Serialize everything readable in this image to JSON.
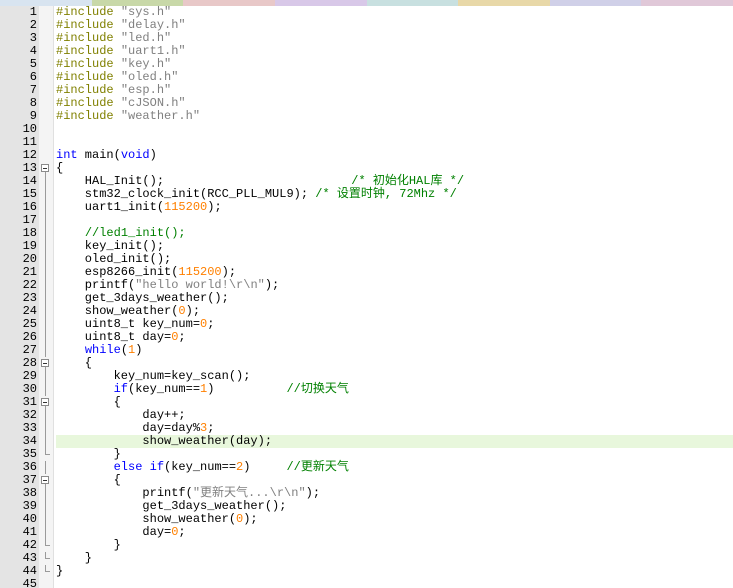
{
  "tab_colors": [
    "#d8e4f0",
    "#c8d8a8",
    "#e8c8c8",
    "#d8c8e8",
    "#c8e0e0",
    "#e8d8a8",
    "#d0d0e8",
    "#e0c8d8"
  ],
  "lines": [
    {
      "n": "1",
      "tokens": [
        {
          "t": "#include ",
          "c": "pp"
        },
        {
          "t": "\"sys.h\"",
          "c": "str"
        }
      ]
    },
    {
      "n": "2",
      "tokens": [
        {
          "t": "#include ",
          "c": "pp"
        },
        {
          "t": "\"delay.h\"",
          "c": "str"
        }
      ]
    },
    {
      "n": "3",
      "tokens": [
        {
          "t": "#include ",
          "c": "pp"
        },
        {
          "t": "\"led.h\"",
          "c": "str"
        }
      ]
    },
    {
      "n": "4",
      "tokens": [
        {
          "t": "#include ",
          "c": "pp"
        },
        {
          "t": "\"uart1.h\"",
          "c": "str"
        }
      ]
    },
    {
      "n": "5",
      "tokens": [
        {
          "t": "#include ",
          "c": "pp"
        },
        {
          "t": "\"key.h\"",
          "c": "str"
        }
      ]
    },
    {
      "n": "6",
      "tokens": [
        {
          "t": "#include ",
          "c": "pp"
        },
        {
          "t": "\"oled.h\"",
          "c": "str"
        }
      ]
    },
    {
      "n": "7",
      "tokens": [
        {
          "t": "#include ",
          "c": "pp"
        },
        {
          "t": "\"esp.h\"",
          "c": "str"
        }
      ]
    },
    {
      "n": "8",
      "tokens": [
        {
          "t": "#include ",
          "c": "pp"
        },
        {
          "t": "\"cJSON.h\"",
          "c": "str"
        }
      ]
    },
    {
      "n": "9",
      "tokens": [
        {
          "t": "#include ",
          "c": "pp"
        },
        {
          "t": "\"weather.h\"",
          "c": "str"
        }
      ]
    },
    {
      "n": "10",
      "tokens": []
    },
    {
      "n": "11",
      "tokens": []
    },
    {
      "n": "12",
      "tokens": [
        {
          "t": "int",
          "c": "kw"
        },
        {
          "t": " main(",
          "c": "plain"
        },
        {
          "t": "void",
          "c": "kw"
        },
        {
          "t": ")",
          "c": "plain"
        }
      ]
    },
    {
      "n": "13",
      "fold": "open",
      "tokens": [
        {
          "t": "{",
          "c": "plain"
        }
      ]
    },
    {
      "n": "14",
      "fold": "line",
      "tokens": [
        {
          "t": "    HAL_Init();                          ",
          "c": "plain"
        },
        {
          "t": "/* 初始化HAL库 */",
          "c": "cmt"
        }
      ]
    },
    {
      "n": "15",
      "fold": "line",
      "tokens": [
        {
          "t": "    stm32_clock_init(RCC_PLL_MUL9); ",
          "c": "plain"
        },
        {
          "t": "/* 设置时钟, 72Mhz */",
          "c": "cmt"
        }
      ]
    },
    {
      "n": "16",
      "fold": "line",
      "tokens": [
        {
          "t": "    uart1_init(",
          "c": "plain"
        },
        {
          "t": "115200",
          "c": "num"
        },
        {
          "t": ");",
          "c": "plain"
        }
      ]
    },
    {
      "n": "17",
      "fold": "line",
      "tokens": [
        {
          "t": "    ",
          "c": "plain"
        }
      ]
    },
    {
      "n": "18",
      "fold": "line",
      "tokens": [
        {
          "t": "    ",
          "c": "plain"
        },
        {
          "t": "//led1_init();",
          "c": "cmt"
        }
      ]
    },
    {
      "n": "19",
      "fold": "line",
      "tokens": [
        {
          "t": "    key_init();",
          "c": "plain"
        }
      ]
    },
    {
      "n": "20",
      "fold": "line",
      "tokens": [
        {
          "t": "    oled_init();",
          "c": "plain"
        }
      ]
    },
    {
      "n": "21",
      "fold": "line",
      "tokens": [
        {
          "t": "    esp8266_init(",
          "c": "plain"
        },
        {
          "t": "115200",
          "c": "num"
        },
        {
          "t": ");",
          "c": "plain"
        }
      ]
    },
    {
      "n": "22",
      "fold": "line",
      "tokens": [
        {
          "t": "    printf(",
          "c": "plain"
        },
        {
          "t": "\"hello world!\\r\\n\"",
          "c": "str"
        },
        {
          "t": ");",
          "c": "plain"
        }
      ]
    },
    {
      "n": "23",
      "fold": "line",
      "tokens": [
        {
          "t": "    get_3days_weather();",
          "c": "plain"
        }
      ]
    },
    {
      "n": "24",
      "fold": "line",
      "tokens": [
        {
          "t": "    show_weather(",
          "c": "plain"
        },
        {
          "t": "0",
          "c": "num"
        },
        {
          "t": ");",
          "c": "plain"
        }
      ]
    },
    {
      "n": "25",
      "fold": "line",
      "tokens": [
        {
          "t": "    uint8_t key_num=",
          "c": "plain"
        },
        {
          "t": "0",
          "c": "num"
        },
        {
          "t": ";",
          "c": "plain"
        }
      ]
    },
    {
      "n": "26",
      "fold": "line",
      "tokens": [
        {
          "t": "    uint8_t day=",
          "c": "plain"
        },
        {
          "t": "0",
          "c": "num"
        },
        {
          "t": ";",
          "c": "plain"
        }
      ]
    },
    {
      "n": "27",
      "fold": "line",
      "tokens": [
        {
          "t": "    ",
          "c": "plain"
        },
        {
          "t": "while",
          "c": "kw"
        },
        {
          "t": "(",
          "c": "plain"
        },
        {
          "t": "1",
          "c": "num"
        },
        {
          "t": ")",
          "c": "plain"
        }
      ]
    },
    {
      "n": "28",
      "fold": "open",
      "tokens": [
        {
          "t": "    {",
          "c": "plain"
        }
      ]
    },
    {
      "n": "29",
      "fold": "line",
      "tokens": [
        {
          "t": "        key_num=key_scan();",
          "c": "plain"
        }
      ]
    },
    {
      "n": "30",
      "fold": "line",
      "tokens": [
        {
          "t": "        ",
          "c": "plain"
        },
        {
          "t": "if",
          "c": "kw"
        },
        {
          "t": "(key_num==",
          "c": "plain"
        },
        {
          "t": "1",
          "c": "num"
        },
        {
          "t": ")          ",
          "c": "plain"
        },
        {
          "t": "//切换天气",
          "c": "cmt"
        }
      ]
    },
    {
      "n": "31",
      "fold": "open",
      "tokens": [
        {
          "t": "        {",
          "c": "plain"
        }
      ]
    },
    {
      "n": "32",
      "fold": "line",
      "tokens": [
        {
          "t": "            day++;",
          "c": "plain"
        }
      ]
    },
    {
      "n": "33",
      "fold": "line",
      "tokens": [
        {
          "t": "            day=day%",
          "c": "plain"
        },
        {
          "t": "3",
          "c": "num"
        },
        {
          "t": ";",
          "c": "plain"
        }
      ]
    },
    {
      "n": "34",
      "fold": "line",
      "active": true,
      "tokens": [
        {
          "t": "            show_weather(day);",
          "c": "plain"
        }
      ]
    },
    {
      "n": "35",
      "fold": "end",
      "tokens": [
        {
          "t": "        }",
          "c": "plain"
        }
      ]
    },
    {
      "n": "36",
      "fold": "line",
      "tokens": [
        {
          "t": "        ",
          "c": "plain"
        },
        {
          "t": "else if",
          "c": "kw"
        },
        {
          "t": "(key_num==",
          "c": "plain"
        },
        {
          "t": "2",
          "c": "num"
        },
        {
          "t": ")     ",
          "c": "plain"
        },
        {
          "t": "//更新天气",
          "c": "cmt"
        }
      ]
    },
    {
      "n": "37",
      "fold": "open",
      "tokens": [
        {
          "t": "        {",
          "c": "plain"
        }
      ]
    },
    {
      "n": "38",
      "fold": "line",
      "tokens": [
        {
          "t": "            printf(",
          "c": "plain"
        },
        {
          "t": "\"更新天气...\\r\\n\"",
          "c": "str"
        },
        {
          "t": ");",
          "c": "plain"
        }
      ]
    },
    {
      "n": "39",
      "fold": "line",
      "tokens": [
        {
          "t": "            get_3days_weather();",
          "c": "plain"
        }
      ]
    },
    {
      "n": "40",
      "fold": "line",
      "tokens": [
        {
          "t": "            show_weather(",
          "c": "plain"
        },
        {
          "t": "0",
          "c": "num"
        },
        {
          "t": ");",
          "c": "plain"
        }
      ]
    },
    {
      "n": "41",
      "fold": "line",
      "tokens": [
        {
          "t": "            day=",
          "c": "plain"
        },
        {
          "t": "0",
          "c": "num"
        },
        {
          "t": ";",
          "c": "plain"
        }
      ]
    },
    {
      "n": "42",
      "fold": "end",
      "tokens": [
        {
          "t": "        }",
          "c": "plain"
        }
      ]
    },
    {
      "n": "43",
      "fold": "end",
      "tokens": [
        {
          "t": "    }",
          "c": "plain"
        }
      ]
    },
    {
      "n": "44",
      "fold": "end",
      "tokens": [
        {
          "t": "}",
          "c": "plain"
        }
      ]
    },
    {
      "n": "45",
      "tokens": []
    }
  ]
}
